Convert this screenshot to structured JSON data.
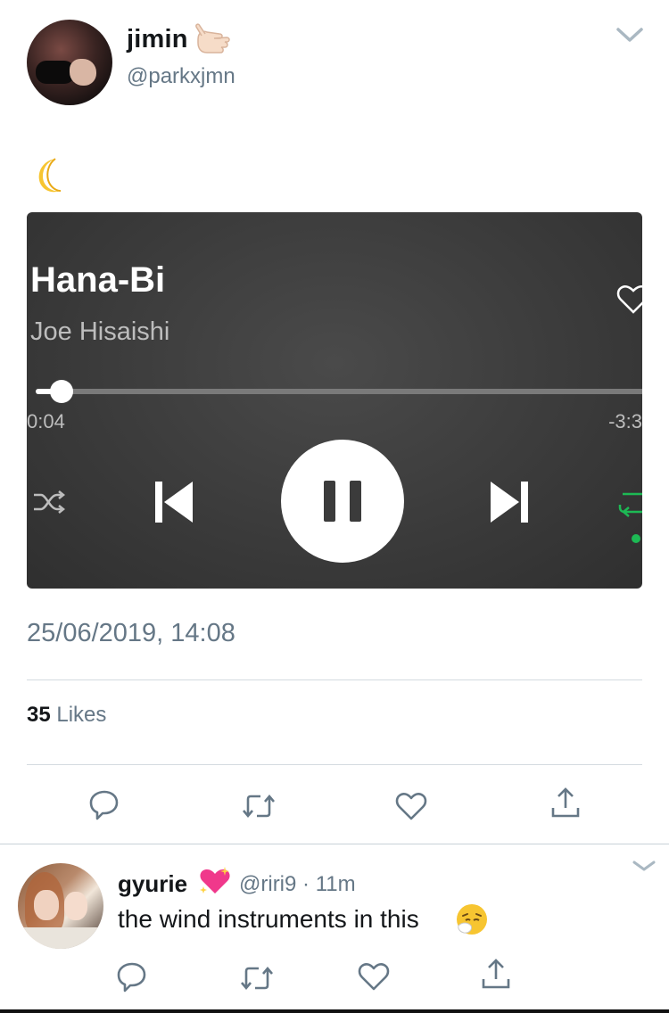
{
  "tweet": {
    "author": {
      "display_name": "jimin",
      "name_emoji": "call-me-hand-emoji",
      "handle": "@parkxjmn"
    },
    "text_emoji": "crescent-moon-emoji",
    "media": {
      "track_title": "Hana-Bi",
      "artist": "Joe Hisaishi",
      "elapsed": "0:04",
      "remaining": "-3:3",
      "progress_fraction": 0.03,
      "repeat_active": true,
      "colors": {
        "accent": "#1db954",
        "panel": "#3b3b3b"
      }
    },
    "timestamp": "25/06/2019, 14:08",
    "likes": {
      "count": "35",
      "label": "Likes"
    },
    "actions": [
      "reply-icon",
      "retweet-icon",
      "like-icon",
      "share-icon"
    ]
  },
  "reply": {
    "display_name": "gyurie",
    "name_emoji": "sparkling-heart-emoji",
    "meta": "@riri9 · 11m",
    "text": "the wind instruments in this",
    "text_emoji": "sneezing-face-emoji",
    "actions": [
      "reply-icon",
      "retweet-icon",
      "like-icon",
      "share-icon"
    ]
  }
}
